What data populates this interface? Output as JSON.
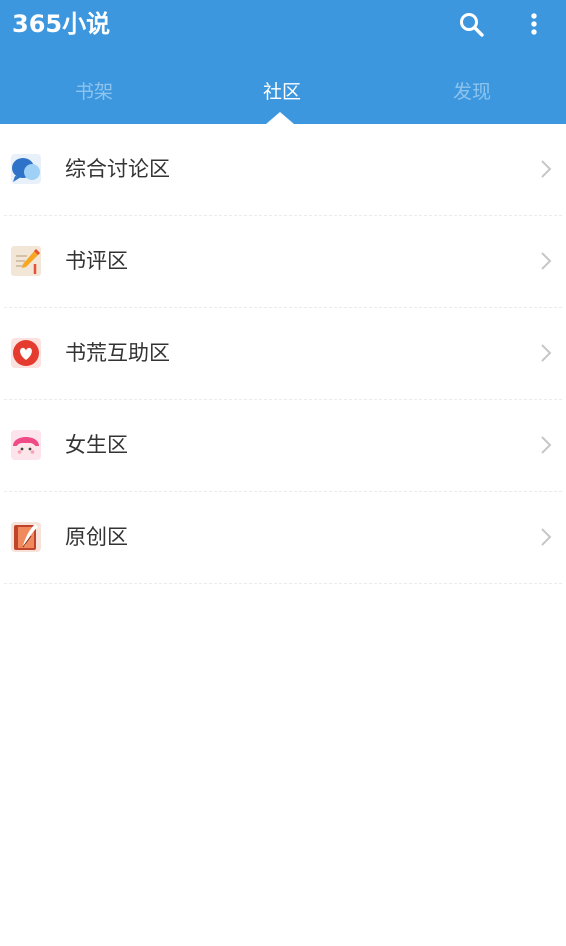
{
  "app": {
    "title": "365小说"
  },
  "header": {
    "search_icon": "search-icon",
    "more_icon": "more-vert-icon"
  },
  "tabs": [
    {
      "label": "书架",
      "active": false
    },
    {
      "label": "社区",
      "active": true
    },
    {
      "label": "发现",
      "active": false
    }
  ],
  "community": {
    "items": [
      {
        "label": "综合讨论区",
        "icon": "chat-bubbles-icon"
      },
      {
        "label": "书评区",
        "icon": "pencil-paper-icon"
      },
      {
        "label": "书荒互助区",
        "icon": "heart-icon"
      },
      {
        "label": "女生区",
        "icon": "girl-face-icon"
      },
      {
        "label": "原创区",
        "icon": "book-quill-icon"
      }
    ]
  },
  "colors": {
    "accent": "#3d97de",
    "tab_inactive": "#8cc4ee",
    "text": "#333333"
  }
}
